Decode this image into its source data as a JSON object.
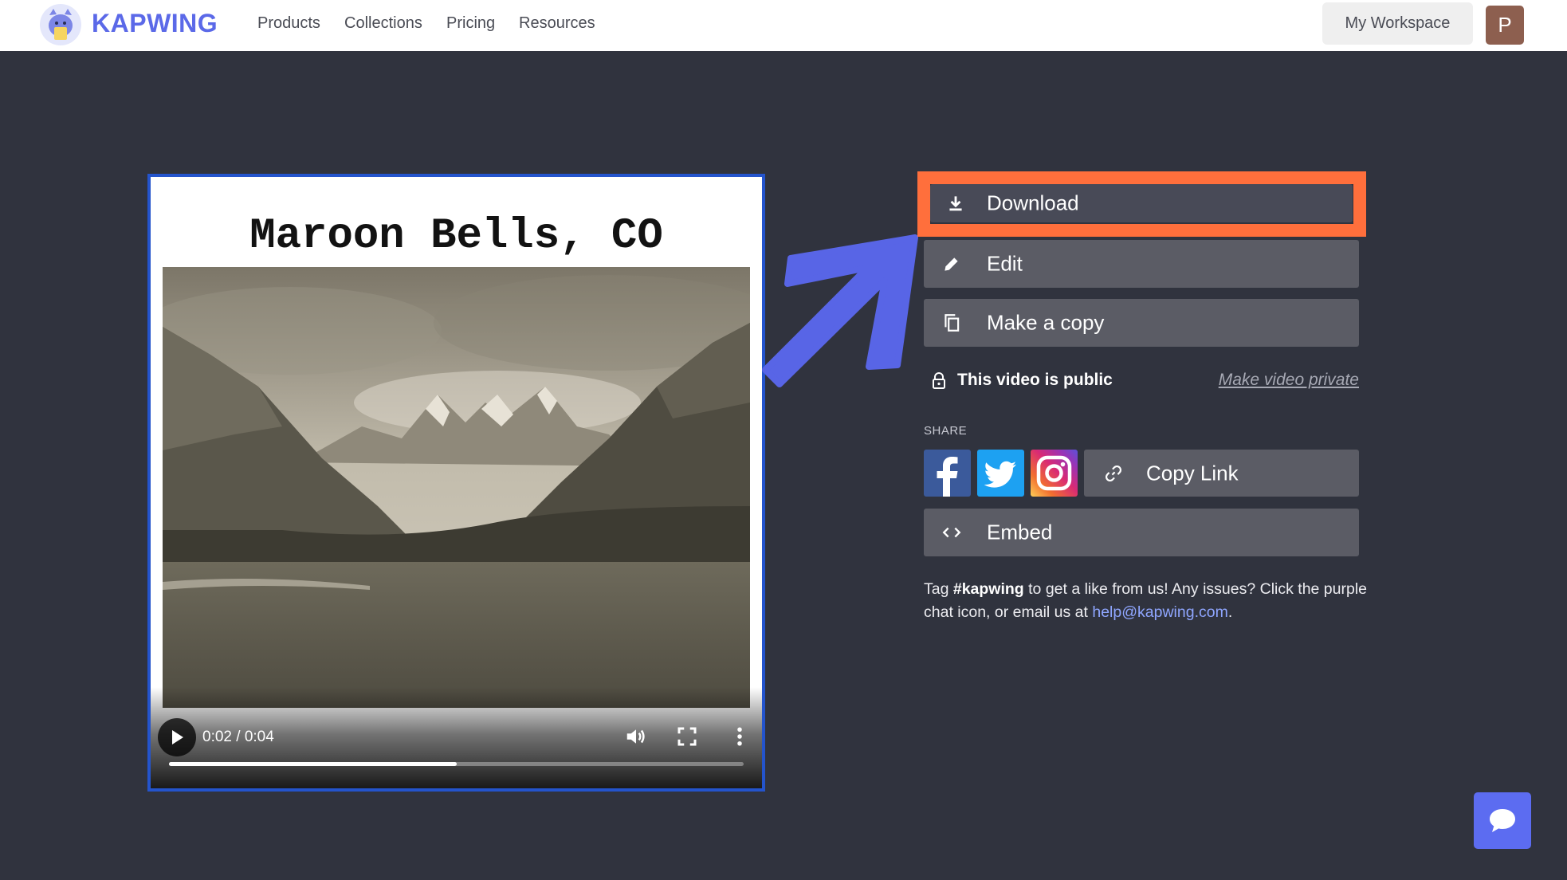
{
  "header": {
    "brand": "KAPWING",
    "nav": [
      "Products",
      "Collections",
      "Pricing",
      "Resources"
    ],
    "workspace_label": "My Workspace",
    "avatar_initial": "P"
  },
  "video": {
    "title": "Maroon Bells, CO",
    "time_readout": "0:02 / 0:04",
    "progress_fraction": 0.5
  },
  "actions": {
    "download_label": "Download",
    "edit_label": "Edit",
    "copy_label": "Make a copy"
  },
  "privacy": {
    "status_text": "This video is public",
    "toggle_label": "Make video private"
  },
  "share": {
    "section_label": "SHARE",
    "copy_link_label": "Copy Link",
    "embed_label": "Embed"
  },
  "help": {
    "prefix": "Tag ",
    "hashtag": "#kapwing",
    "middle": " to get a like from us! Any issues? Click the purple chat icon, or email us at ",
    "email": "help@kapwing.com",
    "suffix": "."
  },
  "colors": {
    "background": "#30333e",
    "brand": "#5b69e8",
    "highlight": "#ff6f3c",
    "annotation_arrow": "#5865e6",
    "player_border": "#2454cc"
  },
  "icons": [
    "kapwing-logo-icon",
    "play-icon",
    "volume-icon",
    "fullscreen-icon",
    "more-options-icon",
    "download-icon",
    "pencil-icon",
    "copy-icon",
    "lock-icon",
    "facebook-icon",
    "twitter-icon",
    "instagram-icon",
    "link-icon",
    "code-icon",
    "chat-icon"
  ]
}
